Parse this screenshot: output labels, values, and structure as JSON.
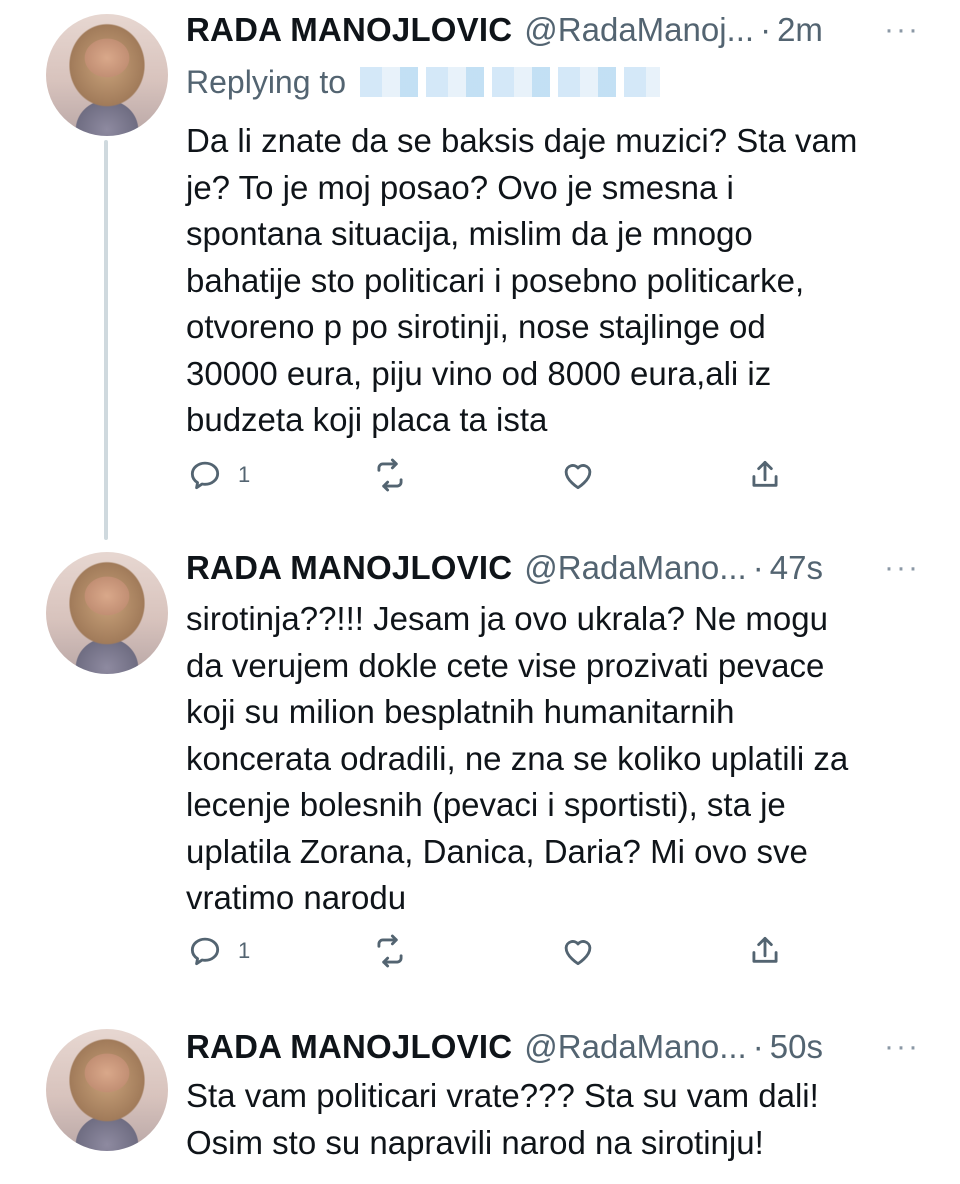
{
  "tweets": [
    {
      "name": "RADA MANOJLOVIC",
      "handle": "@RadaManoj...",
      "separator": "·",
      "time": "2m",
      "more": "···",
      "replying_label": "Replying to",
      "text": "Da li znate da se baksis daje muzici? Sta vam je? To je moj posao? Ovo je smesna i spontana situacija, mislim da je mnogo bahatije sto politicari i posebno politicarke, otvoreno p po sirotinji, nose stajlinge od 30000 eura, piju vino od 8000 eura,ali iz budzeta koji placa ta ista",
      "lines": [
        "Da li znate da se baksis daje muzici? Sta vam",
        "je? To je moj posao? Ovo je smesna i",
        "spontana situacija, mislim da je mnogo",
        "bahatije sto politicari i posebno politicarke,",
        "otvoreno p po sirotinji, nose stajlinge od",
        "30000 eura, piju vino od 8000 eura,ali iz",
        "budzeta koji placa ta ista"
      ],
      "reply_count": "1"
    },
    {
      "name": "RADA MANOJLOVIC",
      "handle": "@RadaMano...",
      "separator": "·",
      "time": "47s",
      "more": "···",
      "lines": [
        "sirotinja??!!! Jesam ja ovo ukrala? Ne mogu",
        "da verujem dokle cete vise prozivati pevace",
        "koji su milion besplatnih humanitarnih",
        "koncerata odradili, ne zna se koliko uplatili za",
        "lecenje bolesnih (pevaci i sportisti), sta je",
        "uplatila Zorana, Danica, Daria? Mi ovo sve",
        "vratimo narodu"
      ],
      "reply_count": "1"
    },
    {
      "name": "RADA MANOJLOVIC",
      "handle": "@RadaMano...",
      "separator": "·",
      "time": "50s",
      "more": "···",
      "lines": [
        "Sta vam politicari vrate??? Sta su vam dali!",
        "Osim sto su napravili narod na sirotinju!"
      ]
    }
  ],
  "icons": [
    "reply-icon",
    "retweet-icon",
    "like-icon",
    "share-icon"
  ],
  "colors": {
    "text": "#0f1419",
    "secondary": "#536471",
    "thread_line": "#cfd9de"
  }
}
